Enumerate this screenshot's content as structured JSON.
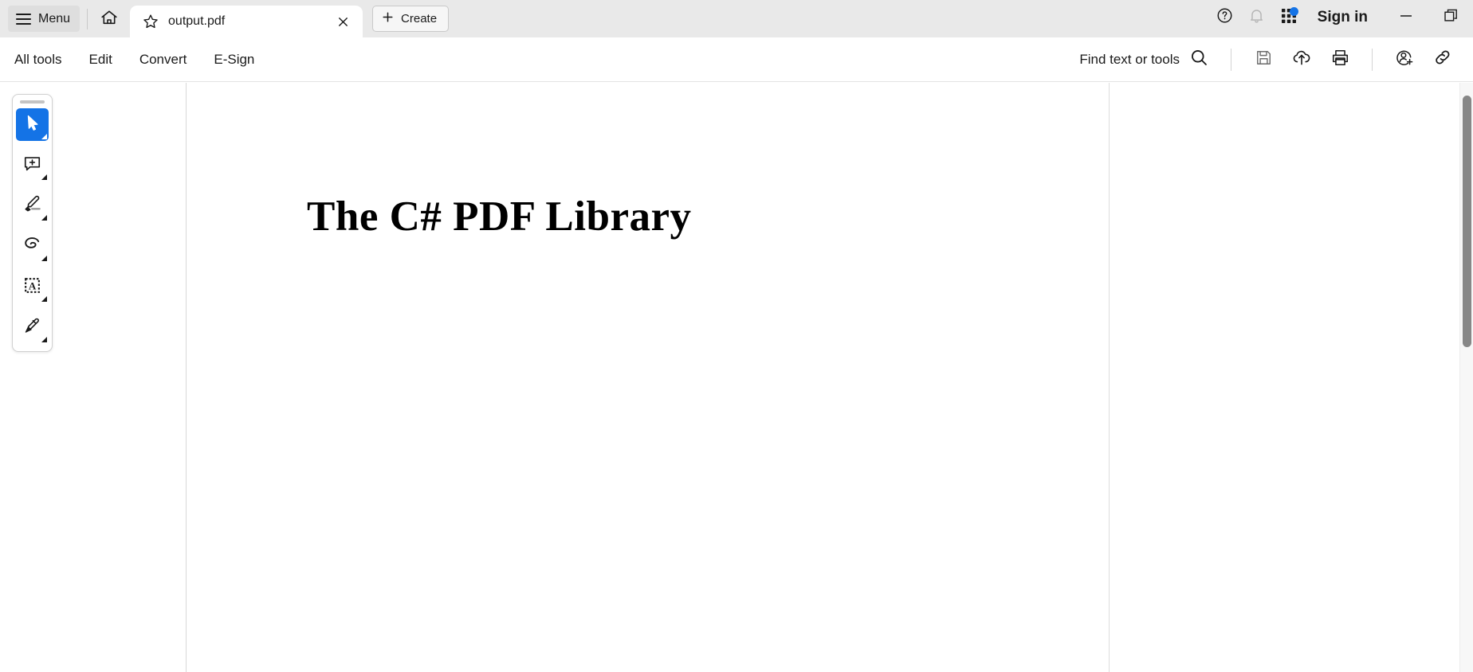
{
  "window": {
    "menu_label": "Menu",
    "signin_label": "Sign in",
    "home_icon": "home-icon",
    "minimize_icon": "minimize-icon",
    "restore_icon": "restore-icon",
    "help_icon": "help-circle-icon",
    "bell_icon": "bell-icon",
    "apps_icon": "app-grid-icon",
    "badge_color": "#1473e6"
  },
  "tab": {
    "title": "output.pdf",
    "star_icon": "star-icon",
    "close_icon": "close-icon",
    "create_label": "Create",
    "plus_icon": "plus-icon"
  },
  "toolbar": {
    "tabs": [
      {
        "label": "All tools",
        "name": "tab-all-tools"
      },
      {
        "label": "Edit",
        "name": "tab-edit"
      },
      {
        "label": "Convert",
        "name": "tab-convert"
      },
      {
        "label": "E-Sign",
        "name": "tab-esign"
      }
    ],
    "find_label": "Find text or tools",
    "search_icon": "search-icon",
    "icons": [
      {
        "name": "save-icon"
      },
      {
        "name": "cloud-upload-icon"
      },
      {
        "name": "print-icon"
      },
      {
        "name": "add-person-icon"
      },
      {
        "name": "share-link-icon"
      }
    ]
  },
  "tool_palette": {
    "drag_handle": "drag-handle",
    "tools": [
      {
        "name": "select-tool",
        "icon": "cursor-arrow-icon",
        "active": true
      },
      {
        "name": "comment-tool",
        "icon": "add-comment-icon",
        "active": false
      },
      {
        "name": "highlight-tool",
        "icon": "highlighter-icon",
        "active": false
      },
      {
        "name": "draw-tool",
        "icon": "freehand-draw-icon",
        "active": false
      },
      {
        "name": "add-text-tool",
        "icon": "text-box-icon",
        "active": false
      },
      {
        "name": "sign-tool",
        "icon": "signature-pen-icon",
        "active": false
      }
    ]
  },
  "document": {
    "heading": "The C# PDF Library"
  },
  "scrollbar": {
    "thumb": "vertical-scroll-thumb"
  }
}
